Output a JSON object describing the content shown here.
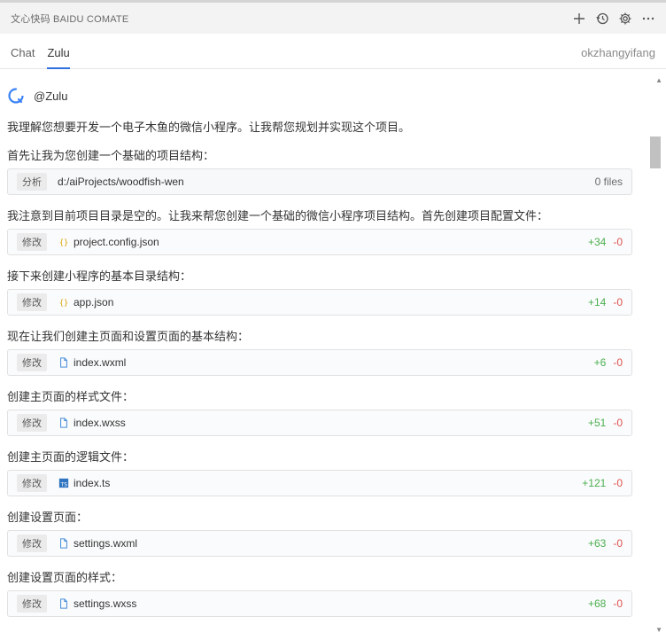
{
  "app": {
    "title": "文心快码 BAIDU COMATE"
  },
  "titlebar": {
    "icons": [
      "plus-icon",
      "history-icon",
      "gear-icon",
      "more-icon"
    ]
  },
  "tabs": [
    {
      "label": "Chat"
    },
    {
      "label": "Zulu"
    }
  ],
  "user": {
    "name": "okzhangyifang"
  },
  "agent": {
    "name": "@Zulu"
  },
  "messages": [
    {
      "text": "我理解您想要开发一个电子木鱼的微信小程序。让我帮您规划并实现这个项目。"
    },
    {
      "text": "首先让我为您创建一个基础的项目结构："
    },
    {
      "text": "我注意到目前项目目录是空的。让我来帮您创建一个基础的微信小程序项目结构。首先创建项目配置文件："
    },
    {
      "text": "接下来创建小程序的基本目录结构："
    },
    {
      "text": "现在让我们创建主页面和设置页面的基本结构："
    },
    {
      "text": "创建主页面的样式文件："
    },
    {
      "text": "创建主页面的逻辑文件："
    },
    {
      "text": "创建设置页面："
    },
    {
      "text": "创建设置页面的样式："
    }
  ],
  "analysis_card": {
    "badge": "分析",
    "path": "d:/aiProjects/woodfish-wen",
    "files": "0 files"
  },
  "file_cards": [
    {
      "badge": "修改",
      "name": "project.config.json",
      "icon": "json-icon",
      "plus": "+34",
      "minus": "-0"
    },
    {
      "badge": "修改",
      "name": "app.json",
      "icon": "json-icon",
      "plus": "+14",
      "minus": "-0"
    },
    {
      "badge": "修改",
      "name": "index.wxml",
      "icon": "file-icon",
      "plus": "+6",
      "minus": "-0"
    },
    {
      "badge": "修改",
      "name": "index.wxss",
      "icon": "file-icon",
      "plus": "+51",
      "minus": "-0"
    },
    {
      "badge": "修改",
      "name": "index.ts",
      "icon": "ts-icon",
      "plus": "+121",
      "minus": "-0"
    },
    {
      "badge": "修改",
      "name": "settings.wxml",
      "icon": "file-icon",
      "plus": "+63",
      "minus": "-0"
    },
    {
      "badge": "修改",
      "name": "settings.wxss",
      "icon": "file-icon",
      "plus": "+68",
      "minus": "-0"
    }
  ],
  "colors": {
    "accent": "#2f6fde",
    "added": "#4caf50",
    "removed": "#e05252"
  }
}
